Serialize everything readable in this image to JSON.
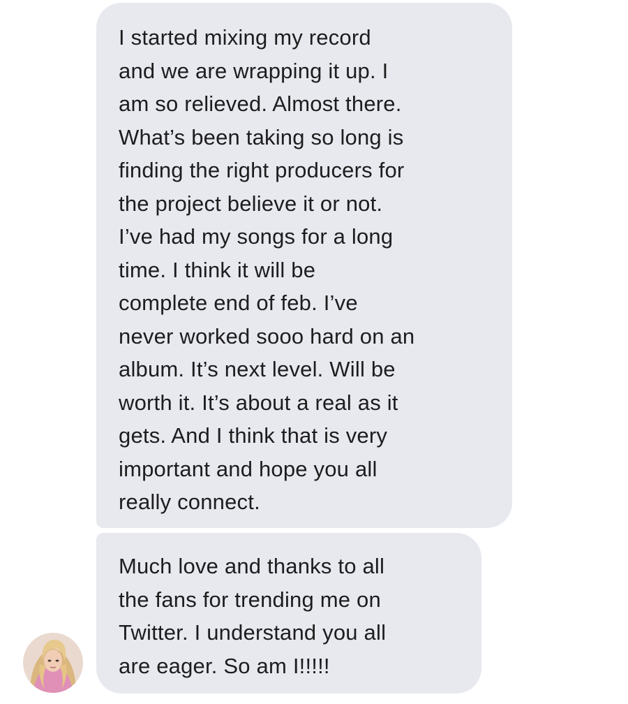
{
  "conversation": {
    "messages": [
      {
        "lines": [
          "I started mixing my record",
          "and we are wrapping it up. I",
          "am so relieved. Almost there.",
          "What’s been taking so long is",
          "finding the right producers for",
          "the project believe it or not.",
          "I’ve had my songs for a long",
          "time. I think it will be",
          "complete end of feb. I’ve",
          "never worked sooo hard on an",
          "album. It’s next level. Will be",
          "worth it. It’s about a real as it",
          "gets. And I think that is very",
          "important and hope you all",
          "really connect."
        ]
      },
      {
        "lines": [
          "Much love and thanks to all",
          "the fans for trending me on",
          "Twitter. I understand you all",
          "are eager. So am I!!!!!"
        ]
      }
    ],
    "sender_avatar_icon": "profile-photo-avatar",
    "colors": {
      "bubble_background": "#e7e9ef",
      "text": "#1d1d1f",
      "page_background": "#ffffff"
    }
  }
}
